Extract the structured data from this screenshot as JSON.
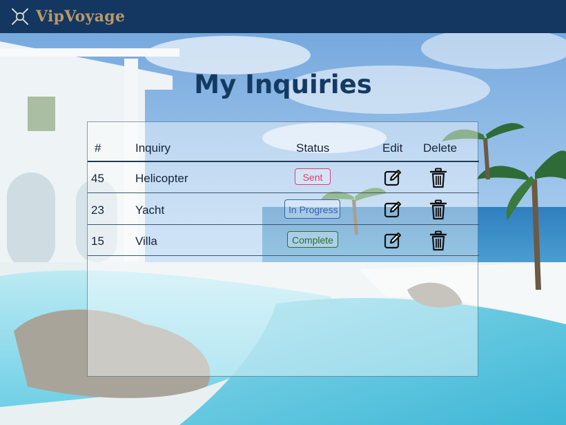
{
  "header": {
    "brand": "VipVoyage",
    "logo_icon": "compass-star-icon",
    "background_color": "#133760",
    "brand_color": "#b9986a"
  },
  "page": {
    "title": "My Inquiries"
  },
  "table": {
    "columns": [
      "#",
      "Inquiry",
      "Status",
      "Edit",
      "Delete"
    ],
    "rows": [
      {
        "id": "45",
        "inquiry": "Helicopter",
        "status": "Sent",
        "status_color": "#e8376f"
      },
      {
        "id": "23",
        "inquiry": "Yacht",
        "status": "In Progress",
        "status_color": "#2f62b3"
      },
      {
        "id": "15",
        "inquiry": "Villa",
        "status": "Complete",
        "status_color": "#2b6e2f"
      }
    ],
    "edit_icon": "edit-pencil-icon",
    "delete_icon": "trash-icon"
  }
}
